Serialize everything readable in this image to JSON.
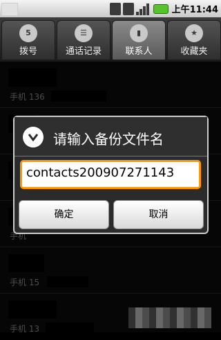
{
  "status_bar": {
    "time_prefix": "上午",
    "time": "11:44",
    "icons": [
      "data-usage-icon",
      "sd-card-icon",
      "signal-icon",
      "battery-icon"
    ]
  },
  "tabs": [
    {
      "label": "拨号",
      "icon": "dialpad-icon",
      "icon_text": "5",
      "active": false
    },
    {
      "label": "通话记录",
      "icon": "call-log-icon",
      "icon_text": "☰",
      "active": false
    },
    {
      "label": "联系人",
      "icon": "contacts-icon",
      "icon_text": "▮",
      "active": true
    },
    {
      "label": "收藏夹",
      "icon": "star-icon",
      "icon_text": "★",
      "active": false
    }
  ],
  "contacts": [
    {
      "phone_label": "手机",
      "phone_visible": "136"
    },
    {
      "phone_label": "",
      "phone_visible": ""
    },
    {
      "phone_label": "",
      "phone_visible": ""
    },
    {
      "phone_label": "手机",
      "phone_visible": ""
    },
    {
      "phone_label": "手机",
      "phone_visible": "15"
    },
    {
      "phone_label": "手机",
      "phone_visible": "13"
    }
  ],
  "dialog": {
    "title": "请输入备份文件名",
    "input_value": "contacts200907271143",
    "ok_label": "确定",
    "cancel_label": "取消"
  },
  "colors": {
    "input_focus_border": "#ff9a00",
    "battery": "#58c12e"
  }
}
